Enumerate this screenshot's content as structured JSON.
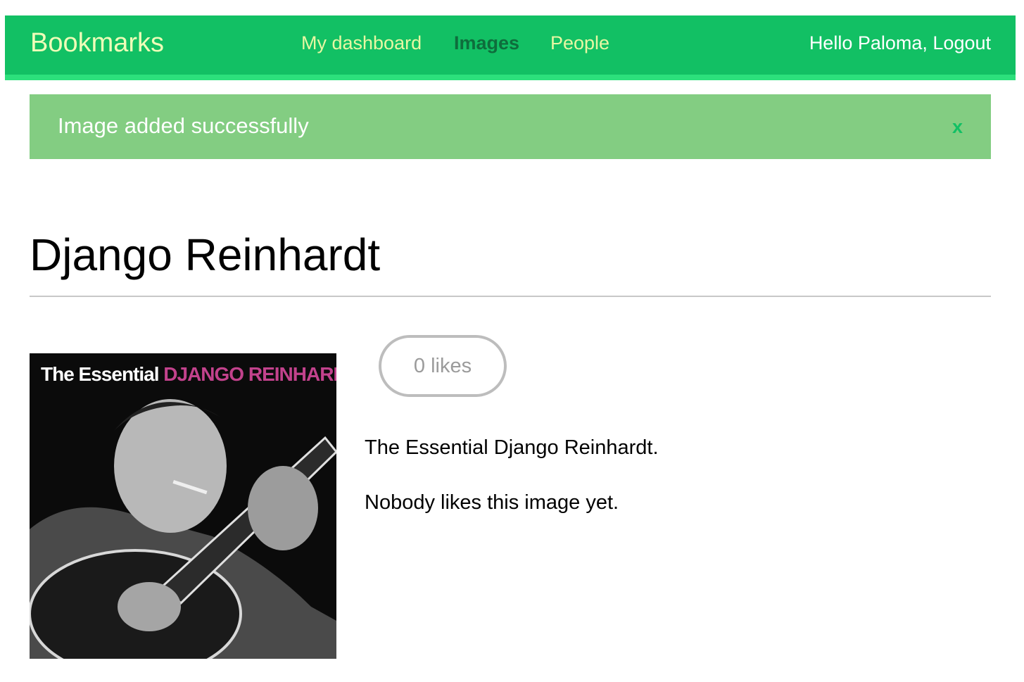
{
  "header": {
    "logo": "Bookmarks",
    "nav": {
      "dashboard": "My dashboard",
      "images": "Images",
      "people": "People"
    },
    "greeting": "Hello Paloma,",
    "logout": "Logout"
  },
  "message": {
    "text": "Image added successfully",
    "close": "x"
  },
  "image": {
    "title": "Django Reinhardt",
    "cover_text_1": "The Essential",
    "cover_text_2": "DJANGO REINHARDT",
    "likes_label": "0 likes",
    "description": "The Essential Django Reinhardt.",
    "likers_text": "Nobody likes this image yet."
  },
  "colors": {
    "header_bg": "#12c064",
    "active_nav": "#0e6d3c",
    "message_bg": "#83cd82",
    "cover_accent": "#c2428c"
  },
  "icons": {
    "close": "close-icon"
  }
}
